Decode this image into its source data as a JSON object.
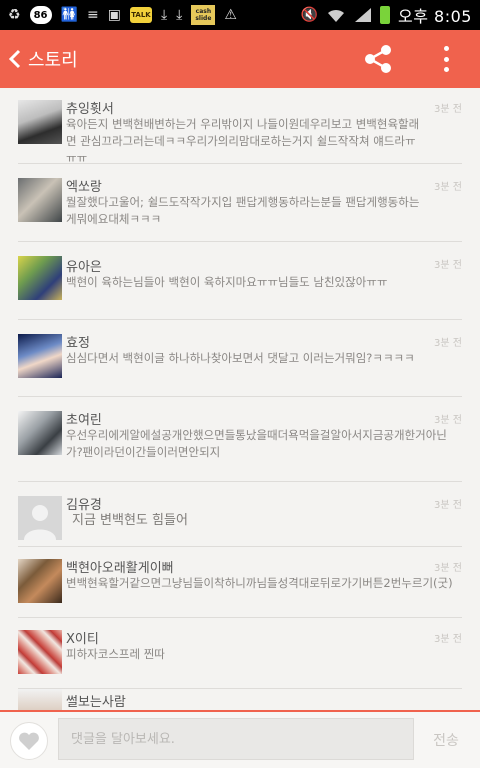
{
  "statusbar": {
    "badge": "86",
    "cashslide": "cash slide",
    "talk": "TALK",
    "clock": "오후 8:05"
  },
  "appbar": {
    "title": "스토리"
  },
  "posts": [
    {
      "name": "츄잉휫서",
      "text": "육아든지 변백현배변하는거 우리밖이지 나들이원데우리보고 변백현육할래면 관심끄라그러는데ㅋㅋ우리가의리맘대로하는거지 쉴드작작쳐 얘드라ㅠㅠㅠ",
      "time": "3분 전"
    },
    {
      "name": "엑쏘랑",
      "text": "뭘잘했다고울어; 쉴드도작작가지입 팬답게행동하라는분들 팬답게행동하는게뭐에요대체ㅋㅋㅋ",
      "time": "3분 전"
    },
    {
      "name": "유아은",
      "text": "백현이 육하는님들아 백현이 육하지마요ㅠㅠ님들도 남친있잖아ㅠㅠ",
      "time": "3분 전"
    },
    {
      "name": "효정",
      "text": "심심다면서 백현이글 하나하나찾아보면서 댓달고 이러는거뭐임?ㅋㅋㅋㅋ",
      "time": "3분 전"
    },
    {
      "name": "초여린",
      "text": "우선우리에게알에설공개안했으면들통났을때더욕먹을걸알아서지금공개한거아닌가?팬이라던이간들이러면안되지",
      "time": "3분 전"
    },
    {
      "name": "김유경",
      "text": "지금 변백현도 힘들어",
      "time": "3분 전"
    },
    {
      "name": "백현아오래활게이뻐",
      "text": "변백현육할거같으면그냥님들이착하니까님들성격대로뒤로가기버튼2번누르기(굿)",
      "time": "3분 전"
    },
    {
      "name": "X이티",
      "text": "피하자코스프레 찐따",
      "time": "3분 전"
    },
    {
      "name": "썰보는사람",
      "text": "",
      "time": ""
    }
  ],
  "comment": {
    "placeholder": "댓글을 달아보세요.",
    "send_label": "전송"
  }
}
